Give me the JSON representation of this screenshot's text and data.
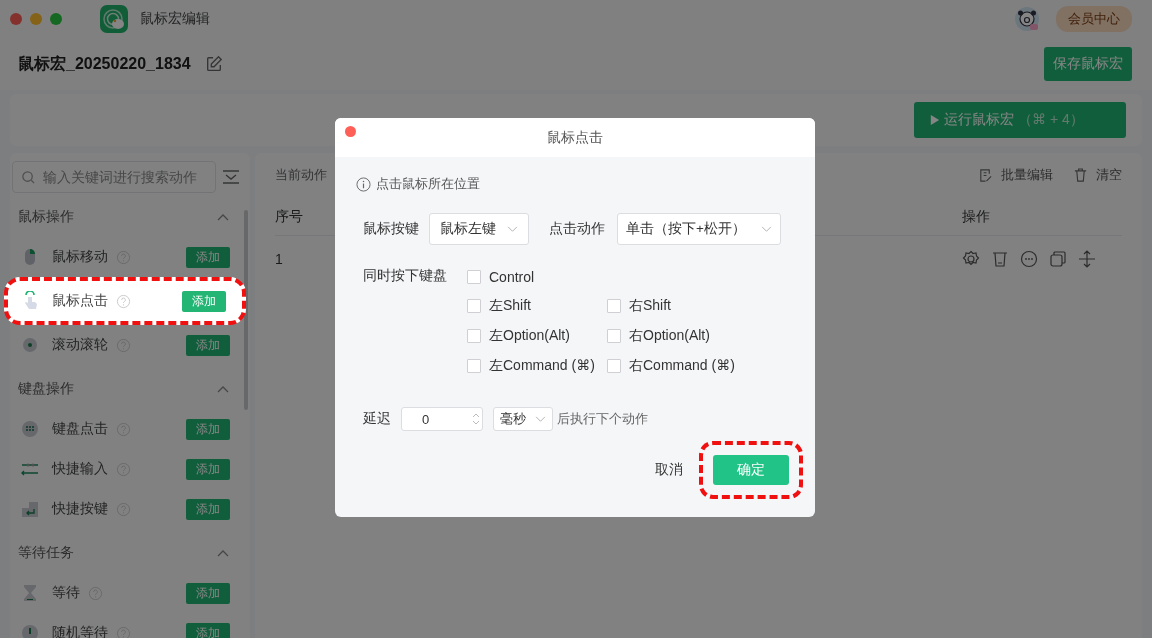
{
  "window": {
    "title": "鼠标宏编辑",
    "member_button": "会员中心"
  },
  "macro": {
    "name": "鼠标宏_20250220_1834",
    "save_button": "保存鼠标宏",
    "run_button": "运行鼠标宏",
    "run_shortcut": "（⌘ + 4）"
  },
  "sidebar": {
    "search_placeholder": "输入关键词进行搜索动作",
    "groups": [
      {
        "title": "鼠标操作",
        "expanded": true,
        "items": [
          {
            "label": "鼠标移动",
            "add": "添加",
            "highlighted": false
          },
          {
            "label": "鼠标点击",
            "add": "添加",
            "highlighted": true
          },
          {
            "label": "滚动滚轮",
            "add": "添加",
            "highlighted": false
          }
        ]
      },
      {
        "title": "键盘操作",
        "expanded": true,
        "items": [
          {
            "label": "键盘点击",
            "add": "添加",
            "highlighted": false
          },
          {
            "label": "快捷输入",
            "add": "添加",
            "highlighted": false
          },
          {
            "label": "快捷按键",
            "add": "添加",
            "highlighted": false
          }
        ]
      },
      {
        "title": "等待任务",
        "expanded": true,
        "items": [
          {
            "label": "等待",
            "add": "添加",
            "highlighted": false
          },
          {
            "label": "随机等待",
            "add": "添加",
            "highlighted": false
          }
        ]
      }
    ]
  },
  "table": {
    "label": "当前动作",
    "actions": [
      "批量编辑",
      "清空"
    ],
    "columns": [
      "序号",
      "操作"
    ],
    "rows": [
      {
        "index": "1"
      }
    ]
  },
  "dialog": {
    "title": "鼠标点击",
    "hint": "点击鼠标所在位置",
    "mouse_button": {
      "label": "鼠标按键",
      "value": "鼠标左键"
    },
    "click_action": {
      "label": "点击动作",
      "value": "单击（按下+松开）"
    },
    "modifiers": {
      "label": "同时按下键盘",
      "rows": [
        {
          "keys": [
            {
              "label": "Control",
              "checked": false
            }
          ]
        },
        {
          "keys": [
            {
              "label": "左Shift",
              "checked": false
            },
            {
              "label": "右Shift",
              "checked": false
            }
          ]
        },
        {
          "keys": [
            {
              "label": "左Option(Alt)",
              "checked": false
            },
            {
              "label": "右Option(Alt)",
              "checked": false
            }
          ]
        },
        {
          "keys": [
            {
              "label": "左Command (⌘)",
              "checked": false
            },
            {
              "label": "右Command (⌘)",
              "checked": false
            }
          ]
        }
      ]
    },
    "delay": {
      "label": "延迟",
      "value": "0",
      "unit": "毫秒",
      "suffix": "后执行下个动作"
    },
    "cancel_button": "取消",
    "confirm_button": "确定",
    "confirm_highlighted": true
  }
}
